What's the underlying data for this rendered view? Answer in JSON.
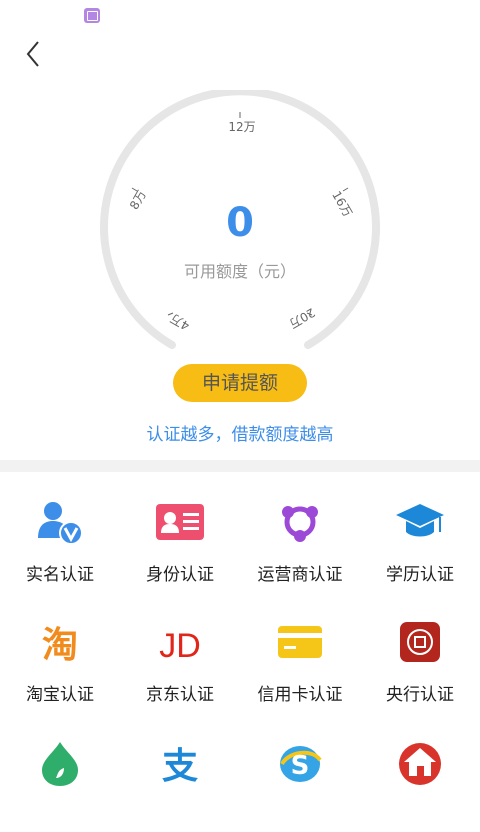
{
  "gauge": {
    "ticks": [
      "4万",
      "8万",
      "12万",
      "16万",
      "20万"
    ],
    "amount": "0",
    "amount_label": "可用额度（元）"
  },
  "apply_button": "申请提额",
  "hint": "认证越多，借款额度越高",
  "auth_items": [
    {
      "label": "实名认证",
      "icon": "real-name-icon"
    },
    {
      "label": "身份认证",
      "icon": "id-card-icon"
    },
    {
      "label": "运营商认证",
      "icon": "carrier-icon"
    },
    {
      "label": "学历认证",
      "icon": "education-icon"
    },
    {
      "label": "淘宝认证",
      "icon": "taobao-icon",
      "glyph": "淘"
    },
    {
      "label": "京东认证",
      "icon": "jd-icon",
      "glyph": "JD"
    },
    {
      "label": "信用卡认证",
      "icon": "credit-card-icon"
    },
    {
      "label": "央行认证",
      "icon": "central-bank-icon"
    },
    {
      "label": "",
      "icon": "drop-icon"
    },
    {
      "label": "",
      "icon": "alipay-icon",
      "glyph": "支"
    },
    {
      "label": "",
      "icon": "social-security-icon",
      "glyph": "S"
    },
    {
      "label": "",
      "icon": "house-icon"
    }
  ],
  "colors": {
    "accent_blue": "#3d8ee8",
    "button_yellow": "#f7bd15",
    "id_pink": "#ef4f6e",
    "carrier_purple": "#9b49d6",
    "taobao_orange": "#f28b1e",
    "jd_red": "#e1251b",
    "card_yellow": "#f5c518",
    "bank_red": "#b3261e",
    "drop_green": "#2fae6b",
    "house_red": "#d9342b",
    "gauge_gray": "#e6e6e6"
  }
}
